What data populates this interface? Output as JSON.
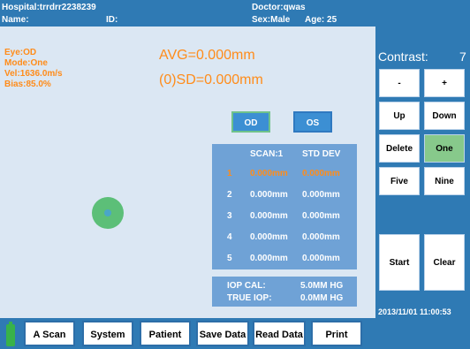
{
  "header": {
    "hospital_label": "Hospital:",
    "hospital_value": "trrdrr2238239",
    "doctor_label": "Doctor:",
    "doctor_value": "qwas",
    "name_label": "Name:",
    "id_label": "ID:",
    "sex_label": "Sex:",
    "sex_value": "Male",
    "age_label": "Age:",
    "age_value": "25"
  },
  "measure_info": {
    "eye": "Eye:OD",
    "mode": "Mode:One",
    "vel": "Vel:1636.0m/s",
    "bias": "Bias:85.0%"
  },
  "stats": {
    "avg": "AVG=0.000mm",
    "sd": "(0)SD=0.000mm"
  },
  "eye_buttons": {
    "od": "OD",
    "os": "OS"
  },
  "scan_table": {
    "header_scan": "SCAN:1",
    "header_std": "STD DEV",
    "rows": [
      {
        "idx": "1",
        "scan": "0.000mm",
        "std": "0.000mm"
      },
      {
        "idx": "2",
        "scan": "0.000mm",
        "std": "0.000mm"
      },
      {
        "idx": "3",
        "scan": "0.000mm",
        "std": "0.000mm"
      },
      {
        "idx": "4",
        "scan": "0.000mm",
        "std": "0.000mm"
      },
      {
        "idx": "5",
        "scan": "0.000mm",
        "std": "0.000mm"
      }
    ]
  },
  "iop": {
    "cal_label": "IOP CAL:",
    "cal_value": "5.0MM HG",
    "true_label": "TRUE IOP:",
    "true_value": "0.0MM HG"
  },
  "right_panel": {
    "contrast_label": "Contrast:",
    "contrast_value": "7",
    "minus": "-",
    "plus": "+",
    "up": "Up",
    "down": "Down",
    "delete": "Delete",
    "one": "One",
    "five": "Five",
    "nine": "Nine",
    "start": "Start",
    "clear": "Clear"
  },
  "bottom_bar": {
    "a_scan": "A Scan",
    "system": "System",
    "patient": "Patient",
    "save_data": "Save Data",
    "read_data": "Read Data",
    "print": "Print"
  },
  "status": {
    "datetime": "2013/11/01   11:00:53"
  },
  "colors": {
    "background": "#2f7ab4",
    "panel": "#dbe7f3",
    "accent_orange": "#ff8c1a",
    "selected_green": "#87c98b"
  }
}
